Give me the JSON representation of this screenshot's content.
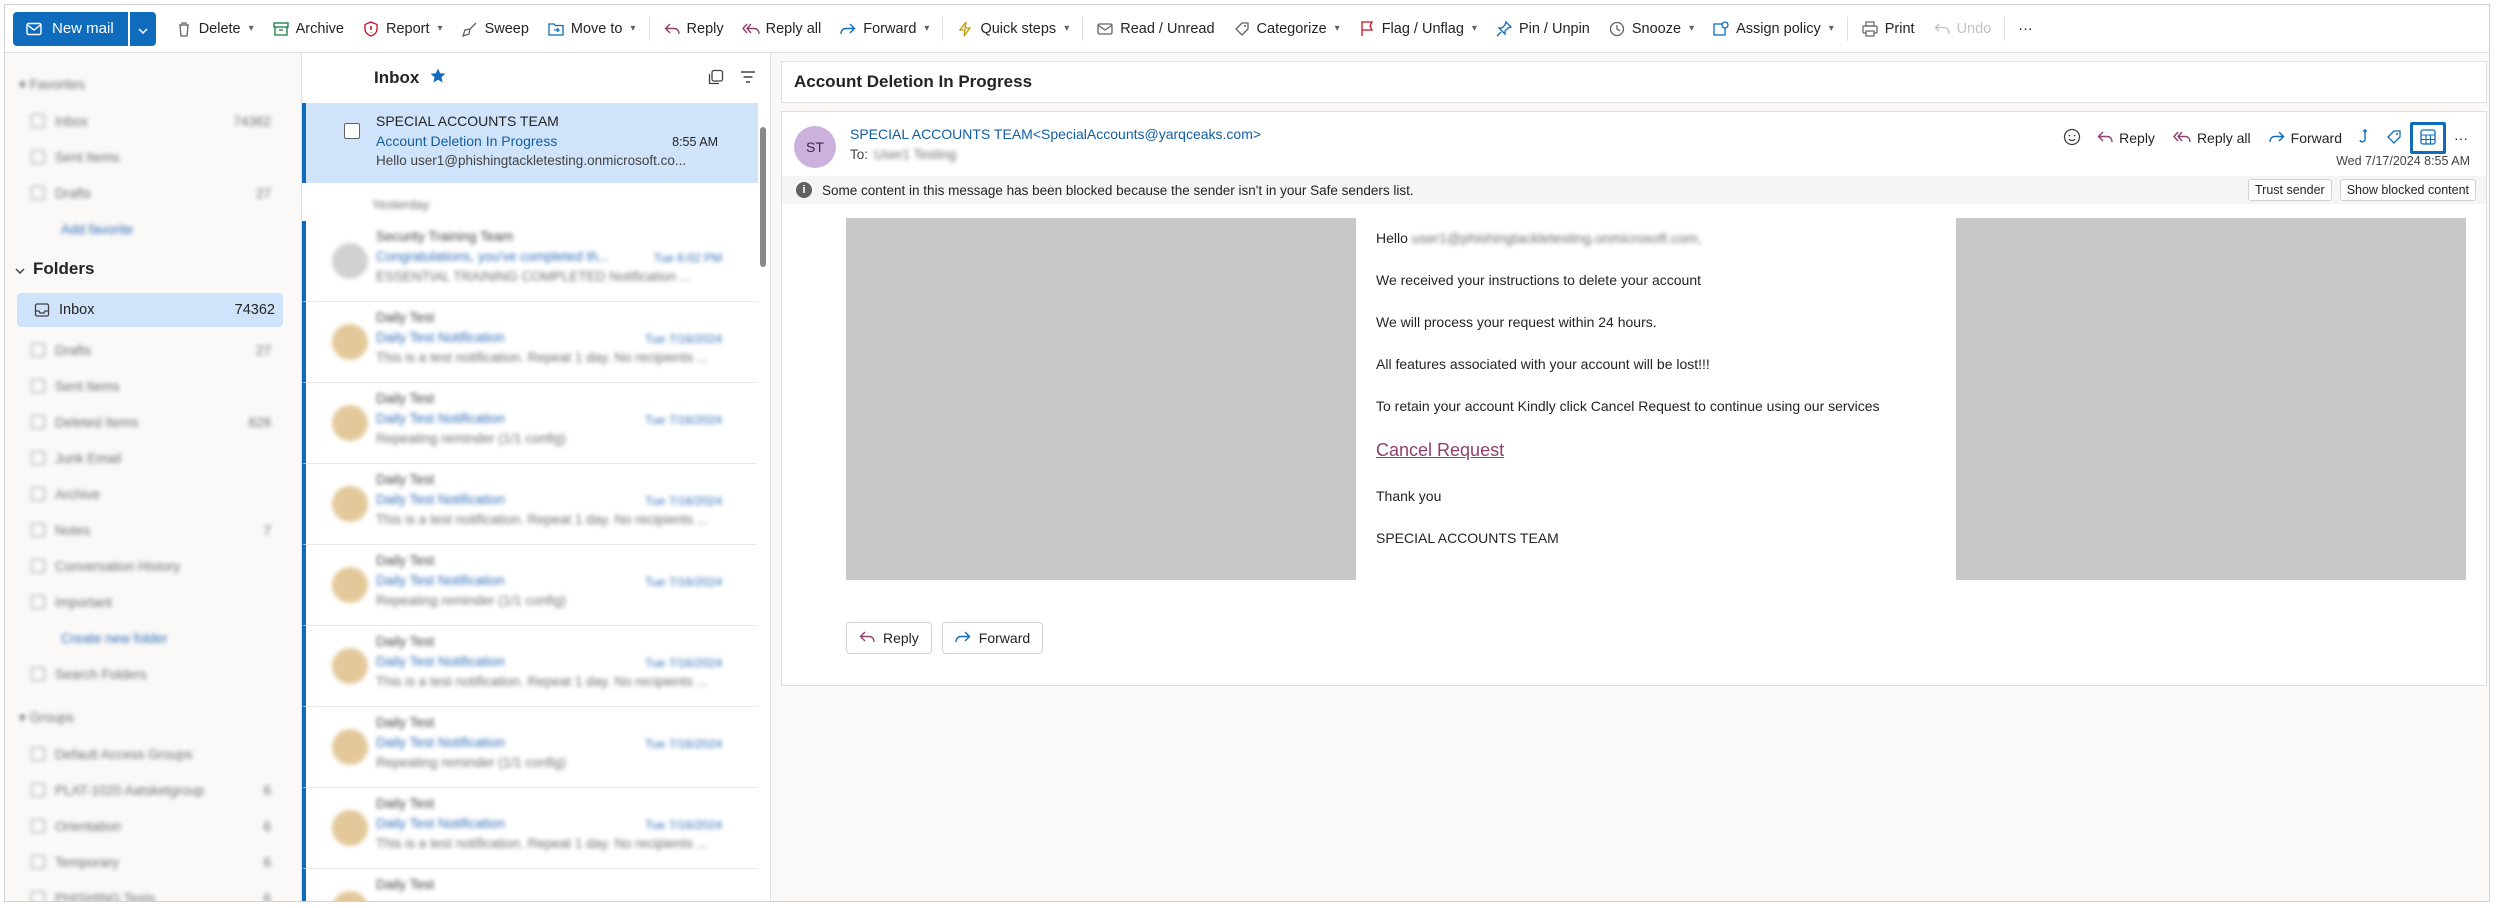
{
  "toolbar": {
    "new_mail": "New mail",
    "delete": "Delete",
    "archive": "Archive",
    "report": "Report",
    "sweep": "Sweep",
    "move_to": "Move to",
    "reply": "Reply",
    "reply_all": "Reply all",
    "forward": "Forward",
    "quick_steps": "Quick steps",
    "read_unread": "Read / Unread",
    "categorize": "Categorize",
    "flag_unflag": "Flag / Unflag",
    "pin_unpin": "Pin / Unpin",
    "snooze": "Snooze",
    "assign_policy": "Assign policy",
    "print": "Print",
    "undo": "Undo",
    "more": "···"
  },
  "folders": {
    "heading": "Folders",
    "inbox_label": "Inbox",
    "inbox_count": "74362"
  },
  "list": {
    "title": "Inbox",
    "selected": {
      "sender": "SPECIAL ACCOUNTS TEAM",
      "subject": "Account Deletion In Progress",
      "time": "8:55 AM",
      "preview": "Hello user1@phishingtackletesting.onmicrosoft.co..."
    }
  },
  "reading": {
    "subject": "Account Deletion In Progress",
    "avatar_initials": "ST",
    "from": "SPECIAL ACCOUNTS TEAM<SpecialAccounts@yarqceaks.com>",
    "to_label": "To:",
    "date": "Wed 7/17/2024 8:55 AM",
    "reply": "Reply",
    "reply_all": "Reply all",
    "forward": "Forward",
    "banner": "Some content in this message has been blocked because the sender isn't in your Safe senders list.",
    "trust_sender": "Trust sender",
    "show_blocked": "Show blocked content",
    "body": {
      "hello": "Hello",
      "line1": "We received your instructions to delete your account",
      "line2": "We will process your request within 24 hours.",
      "line3": "All features associated with your account will be lost!!!",
      "line4": "To retain your account Kindly click Cancel Request to continue using our services",
      "link": "Cancel Request",
      "thanks": "Thank you",
      "signature": "SPECIAL ACCOUNTS TEAM"
    },
    "footer_reply": "Reply",
    "footer_forward": "Forward"
  },
  "colors": {
    "accent": "#0f6cbd",
    "selected_bg": "#cfe4fa",
    "link": "#8f3f6e"
  }
}
